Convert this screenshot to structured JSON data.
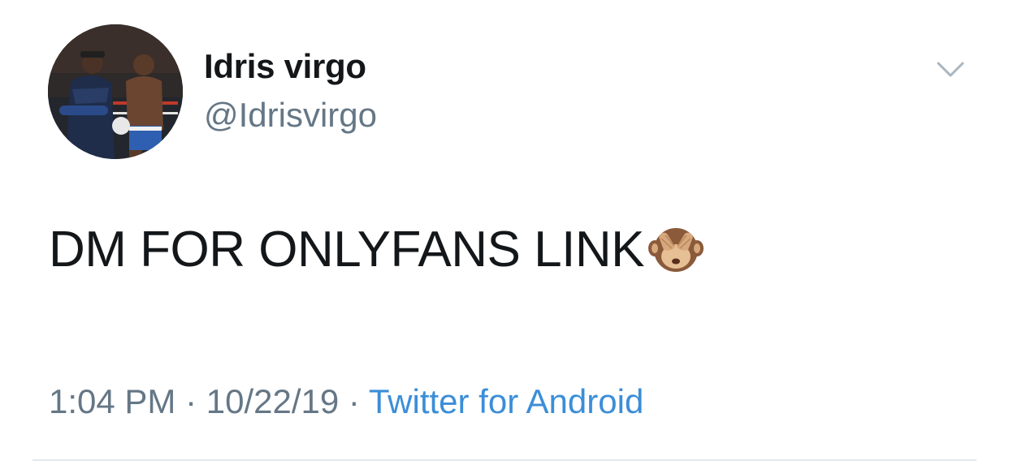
{
  "tweet": {
    "author": {
      "display_name": "Idris virgo",
      "handle": "@Idrisvirgo",
      "avatar": "boxing-photo-avatar"
    },
    "text": "DM FOR ONLYFANS LINK",
    "emoji": "see-no-evil-monkey",
    "meta": {
      "time": "1:04 PM",
      "separator": " · ",
      "date": "10/22/19",
      "source": "Twitter for Android"
    },
    "menu_icon": "chevron-down-icon"
  },
  "colors": {
    "text_primary": "#14171a",
    "text_secondary": "#657786",
    "link": "#3b8ed8",
    "divider": "#e1e8ed"
  }
}
